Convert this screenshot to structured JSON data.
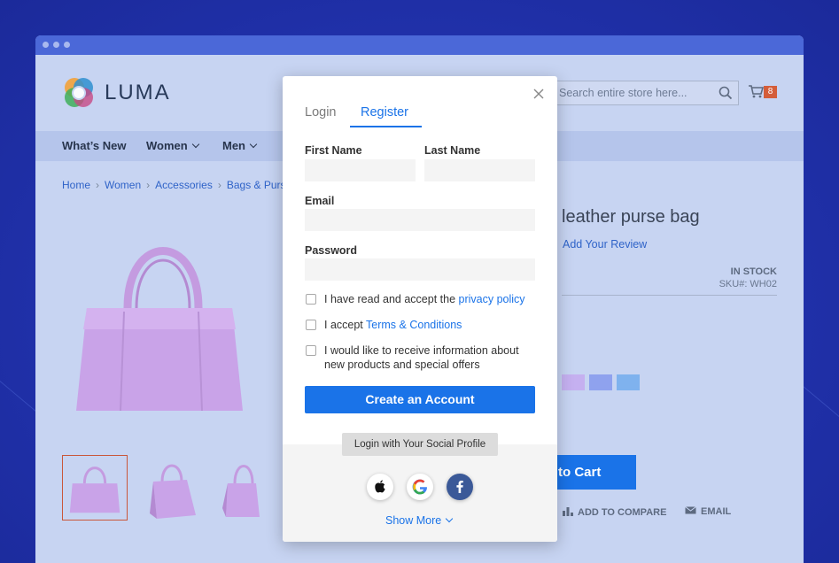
{
  "header": {
    "logo_text": "LUMA",
    "search_placeholder": "Search entire store here...",
    "cart_count": "8"
  },
  "nav": [
    {
      "label": "What’s New"
    },
    {
      "label": "Women"
    },
    {
      "label": "Men"
    }
  ],
  "breadcrumbs": [
    "Home",
    "Women",
    "Accessories",
    "Bags & Purse"
  ],
  "product": {
    "title": "leather purse bag",
    "review_link": "Add Your Review",
    "stock": "IN STOCK",
    "sku": "SKU#: WH02",
    "add_to_cart": "to Cart",
    "compare": "ADD TO COMPARE",
    "email": "EMAIL",
    "swatch_colors": [
      "#c5b0f0",
      "#8fa2ee",
      "#7fb2ee"
    ]
  },
  "modal": {
    "tabs": [
      "Login",
      "Register"
    ],
    "active_tab": "Register",
    "first_name_label": "First Name",
    "last_name_label": "Last Name",
    "email_label": "Email",
    "password_label": "Password",
    "checkbox_privacy_text": "I have read and accept the ",
    "checkbox_privacy_link": "privacy policy",
    "checkbox_terms_text": "I accept ",
    "checkbox_terms_link": "Terms & Conditions",
    "checkbox_news_line1": "I would like to receive information about",
    "checkbox_news_line2": "new products and special offers",
    "create_button": "Create an Account",
    "social_label": "Login with Your Social Profile",
    "social_buttons": [
      "apple-icon",
      "google-icon",
      "facebook-icon"
    ],
    "show_more": "Show More"
  },
  "colors": {
    "accent": "#1a73e8",
    "page_bg": "#1f2fa3"
  }
}
